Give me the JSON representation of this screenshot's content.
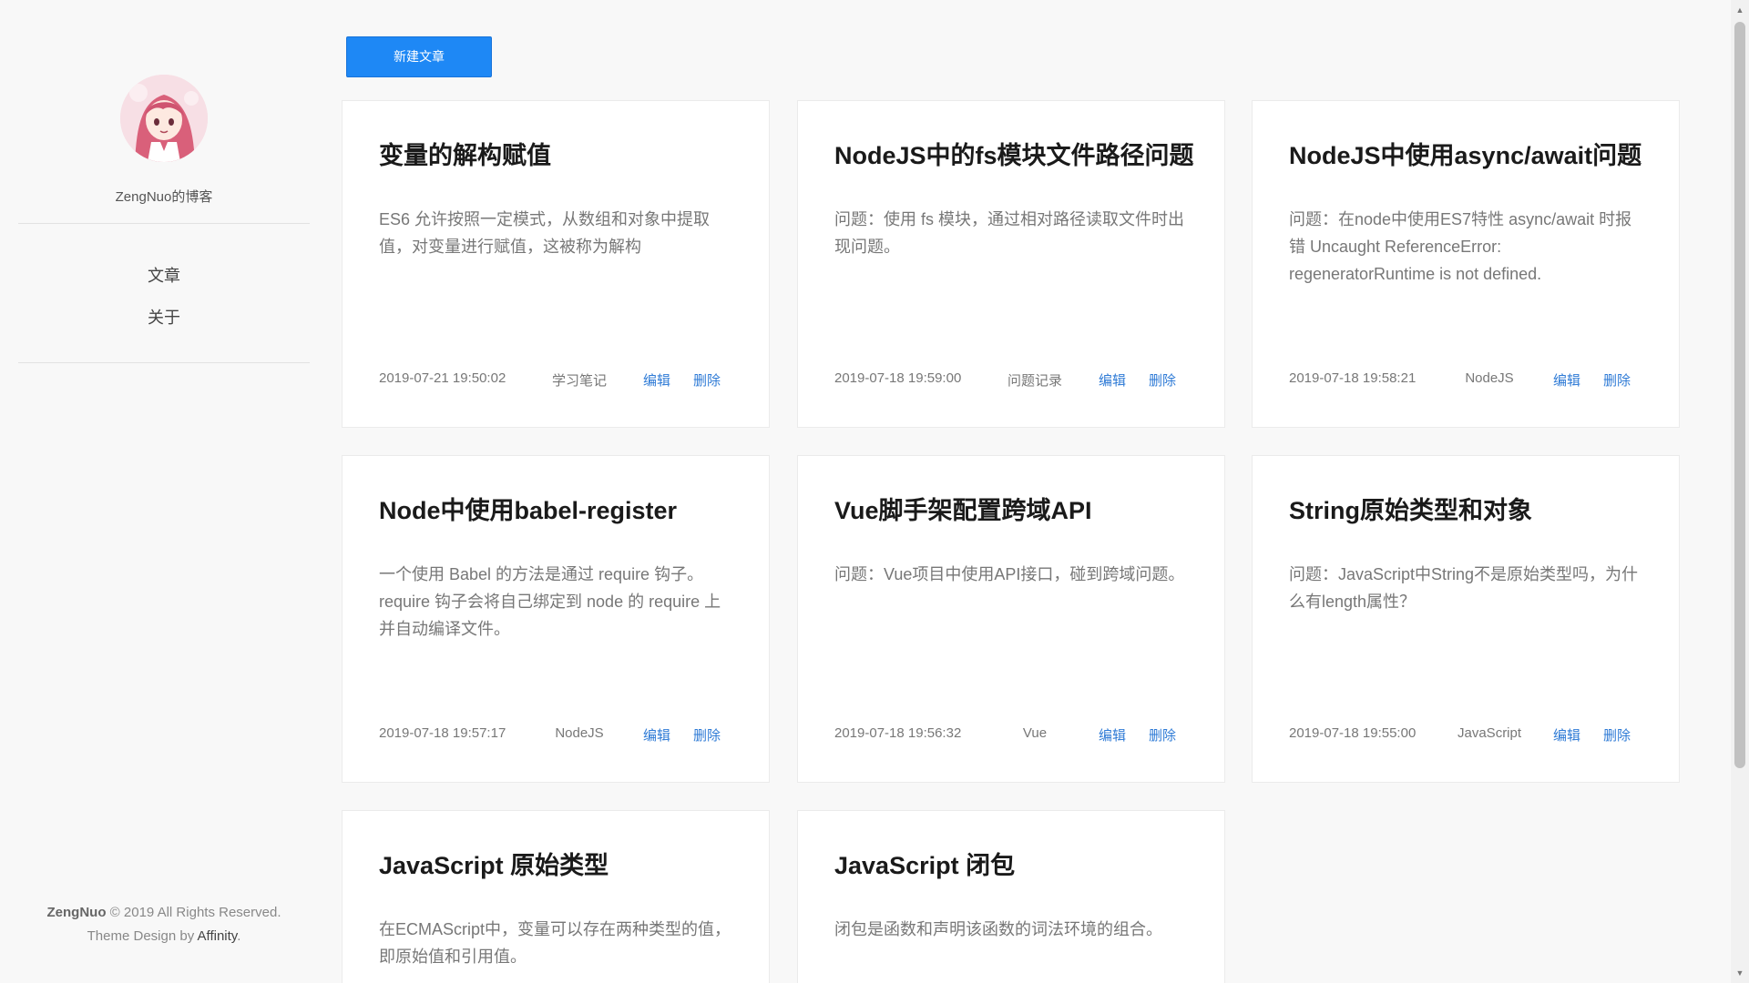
{
  "sidebar": {
    "blog_name": "ZengNuo的博客",
    "nav": [
      {
        "label": "文章"
      },
      {
        "label": "关于"
      }
    ],
    "footer": {
      "author": "ZengNuo",
      "copyright": " © 2019 All Rights Reserved.",
      "theme_prefix": "Theme Design by ",
      "theme_brand": "Affinity",
      "theme_suffix": "."
    }
  },
  "toolbar": {
    "new_post_label": "新建文章"
  },
  "posts": [
    {
      "title": "变量的解构赋值",
      "summary": "ES6 允许按照一定模式，从数组和对象中提取值，对变量进行赋值，这被称为解构",
      "date": "2019-07-21 19:50:02",
      "category": "学习笔记",
      "edit_label": "编辑",
      "delete_label": "删除"
    },
    {
      "title": "NodeJS中的fs模块文件路径问题",
      "summary": "问题：使用 fs 模块，通过相对路径读取文件时出现问题。",
      "date": "2019-07-18 19:59:00",
      "category": "问题记录",
      "edit_label": "编辑",
      "delete_label": "删除"
    },
    {
      "title": "NodeJS中使用async/await问题",
      "summary": "问题：在node中使用ES7特性 async/await 时报错 Uncaught ReferenceError: regeneratorRuntime is not defined.",
      "date": "2019-07-18 19:58:21",
      "category": "NodeJS",
      "edit_label": "编辑",
      "delete_label": "删除"
    },
    {
      "title": "Node中使用babel-register",
      "summary": "一个使用 Babel 的方法是通过 require 钩子。require 钩子会将自己绑定到 node 的 require 上并自动编译文件。",
      "date": "2019-07-18 19:57:17",
      "category": "NodeJS",
      "edit_label": "编辑",
      "delete_label": "删除"
    },
    {
      "title": "Vue脚手架配置跨域API",
      "summary": "问题：Vue项目中使用API接口，碰到跨域问题。",
      "date": "2019-07-18 19:56:32",
      "category": "Vue",
      "edit_label": "编辑",
      "delete_label": "删除"
    },
    {
      "title": "String原始类型和对象",
      "summary": "问题：JavaScript中String不是原始类型吗，为什么有length属性？",
      "date": "2019-07-18 19:55:00",
      "category": "JavaScript",
      "edit_label": "编辑",
      "delete_label": "删除"
    },
    {
      "title": "JavaScript 原始类型",
      "summary": "在ECMAScript中，变量可以存在两种类型的值，即原始值和引用值。",
      "date": "",
      "category": "",
      "edit_label": "",
      "delete_label": ""
    },
    {
      "title": "JavaScript 闭包",
      "summary": "闭包是函数和声明该函数的词法环境的组合。",
      "date": "",
      "category": "",
      "edit_label": "",
      "delete_label": ""
    }
  ],
  "icons": {
    "scroll_up": "scroll-up-arrow-icon",
    "scroll_down": "scroll-down-arrow-icon"
  },
  "colors": {
    "accent": "#1e88f5",
    "link": "#2f7bd6"
  }
}
